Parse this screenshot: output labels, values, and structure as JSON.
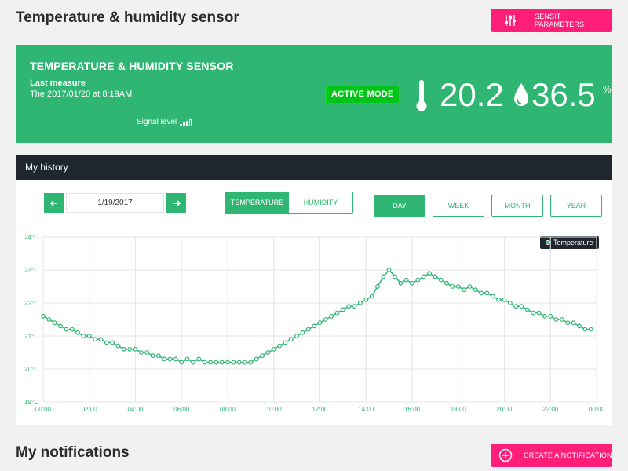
{
  "page": {
    "title": "Temperature & humidity sensor",
    "params_button": "SENSIT PARAMETERS"
  },
  "sensor": {
    "name": "TEMPERATURE & HUMIDITY SENSOR",
    "last_measure_label": "Last measure",
    "last_measure_value": "The 2017/01/20 at 8:19AM",
    "signal_label": "Signal level",
    "signal_bars": 3,
    "signal_bars_total": 4,
    "mode": "ACTIVE MODE",
    "temperature": "20.2",
    "humidity": "36.5",
    "humidity_unit": "%"
  },
  "history": {
    "title": "My history",
    "date": "1/19/2017",
    "prev_icon": "arrow-left-icon",
    "next_icon": "arrow-right-icon",
    "tabs": [
      {
        "label": "TEMPERATURE",
        "active": true
      },
      {
        "label": "HUMIDITY",
        "active": false
      }
    ],
    "ranges": [
      {
        "label": "DAY",
        "active": true
      },
      {
        "label": "WEEK",
        "active": false
      },
      {
        "label": "MONTH",
        "active": false
      },
      {
        "label": "YEAR",
        "active": false
      }
    ]
  },
  "notifications": {
    "title": "My notifications",
    "create_button": "CREATE A NOTIFICATION"
  },
  "colors": {
    "accent_green": "#2fb673",
    "pink": "#ff1f79",
    "active_badge": "#00c417",
    "dark_header": "#1f262d"
  },
  "chart_data": {
    "type": "line",
    "series": [
      {
        "name": "Temperature",
        "x": [
          "00:00",
          "00:15",
          "00:30",
          "00:45",
          "01:00",
          "01:15",
          "01:30",
          "01:45",
          "02:00",
          "02:15",
          "02:30",
          "02:45",
          "03:00",
          "03:15",
          "03:30",
          "03:45",
          "04:00",
          "04:15",
          "04:30",
          "04:45",
          "05:00",
          "05:15",
          "05:30",
          "05:45",
          "06:00",
          "06:15",
          "06:30",
          "06:45",
          "07:00",
          "07:15",
          "07:30",
          "07:45",
          "08:00",
          "08:15",
          "08:30",
          "08:45",
          "09:00",
          "09:15",
          "09:30",
          "09:45",
          "10:00",
          "10:15",
          "10:30",
          "10:45",
          "11:00",
          "11:15",
          "11:30",
          "11:45",
          "12:00",
          "12:15",
          "12:30",
          "12:45",
          "13:00",
          "13:15",
          "13:30",
          "13:45",
          "14:00",
          "14:15",
          "14:30",
          "14:45",
          "15:00",
          "15:15",
          "15:30",
          "15:45",
          "16:00",
          "16:15",
          "16:30",
          "16:45",
          "17:00",
          "17:15",
          "17:30",
          "17:45",
          "18:00",
          "18:15",
          "18:30",
          "18:45",
          "19:00",
          "19:15",
          "19:30",
          "19:45",
          "20:00",
          "20:15",
          "20:30",
          "20:45",
          "21:00",
          "21:15",
          "21:30",
          "21:45",
          "22:00",
          "22:15",
          "22:30",
          "22:45",
          "23:00",
          "23:15",
          "23:30",
          "23:45"
        ],
        "values": [
          21.6,
          21.5,
          21.4,
          21.3,
          21.2,
          21.2,
          21.1,
          21.0,
          21.0,
          20.9,
          20.9,
          20.8,
          20.8,
          20.7,
          20.6,
          20.6,
          20.6,
          20.5,
          20.5,
          20.4,
          20.4,
          20.3,
          20.3,
          20.3,
          20.2,
          20.3,
          20.2,
          20.3,
          20.2,
          20.2,
          20.2,
          20.2,
          20.2,
          20.2,
          20.2,
          20.2,
          20.2,
          20.3,
          20.4,
          20.5,
          20.6,
          20.7,
          20.8,
          20.9,
          21.0,
          21.1,
          21.2,
          21.3,
          21.4,
          21.5,
          21.6,
          21.7,
          21.8,
          21.9,
          21.9,
          22.0,
          22.1,
          22.2,
          22.5,
          22.8,
          23.0,
          22.8,
          22.6,
          22.7,
          22.6,
          22.7,
          22.8,
          22.9,
          22.8,
          22.7,
          22.6,
          22.5,
          22.5,
          22.4,
          22.5,
          22.4,
          22.3,
          22.3,
          22.2,
          22.1,
          22.1,
          22.0,
          21.9,
          21.9,
          21.8,
          21.7,
          21.7,
          21.6,
          21.6,
          21.5,
          21.5,
          21.4,
          21.4,
          21.3,
          21.2,
          21.2
        ]
      }
    ],
    "xlabel": "",
    "ylabel": "",
    "xticks": [
      "00:00",
      "02:00",
      "04:00",
      "06:00",
      "08:00",
      "10:00",
      "12:00",
      "14:00",
      "16:00",
      "18:00",
      "20:00",
      "22:00",
      "00:00"
    ],
    "yticks": [
      "19°C",
      "20°C",
      "21°C",
      "22°C",
      "23°C",
      "24°C"
    ],
    "ylim": [
      19,
      24
    ],
    "grid": true,
    "legend": "top-right"
  }
}
